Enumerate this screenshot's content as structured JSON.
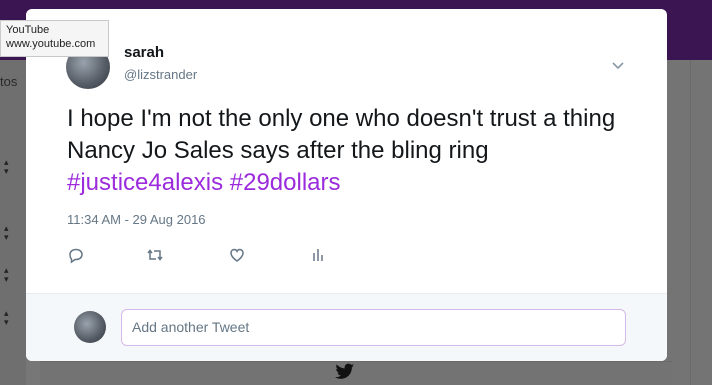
{
  "tooltip": {
    "title": "YouTube",
    "url": "www.youtube.com"
  },
  "background": {
    "tab_fragment": "tos"
  },
  "tweet": {
    "name": "sarah",
    "handle": "@lizstrander",
    "text_plain": "I hope I'm not the only one who doesn't trust a thing Nancy Jo Sales says after the bling ring ",
    "hashtags": [
      "#justice4alexis",
      "#29dollars"
    ],
    "timestamp": "11:34 AM - 29 Aug 2016",
    "actions": [
      "reply-icon",
      "retweet-icon",
      "like-icon",
      "analytics-icon"
    ]
  },
  "reply": {
    "placeholder": "Add another Tweet"
  },
  "colors": {
    "accent": "#9b2bdc",
    "topbar": "#3a1551"
  }
}
